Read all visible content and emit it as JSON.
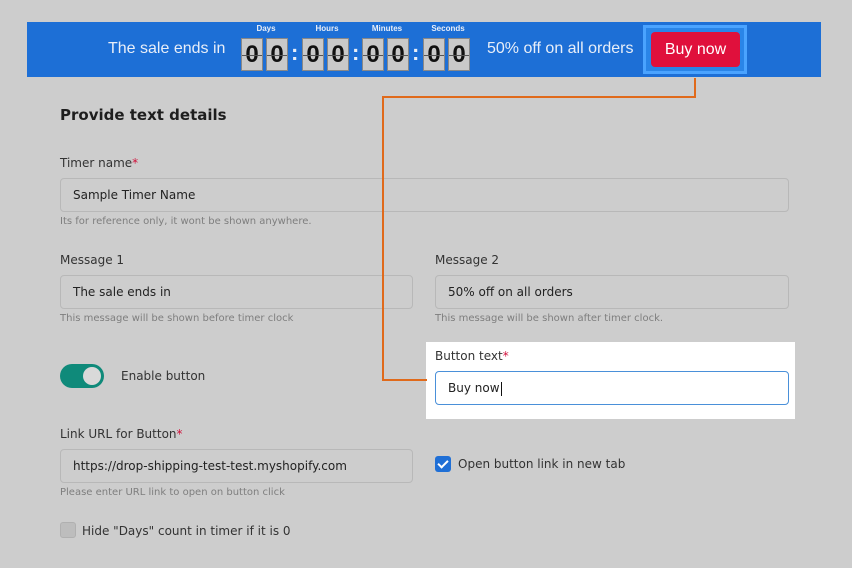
{
  "banner": {
    "message1": "The sale ends in",
    "message2": "50% off on all orders",
    "button_label": "Buy now",
    "timer": {
      "days_label": "Days",
      "hours_label": "Hours",
      "minutes_label": "Minutes",
      "seconds_label": "Seconds",
      "days": [
        "0",
        "0"
      ],
      "hours": [
        "0",
        "0"
      ],
      "minutes": [
        "0",
        "0"
      ],
      "seconds": [
        "0",
        "0"
      ],
      "separator": ":"
    }
  },
  "form": {
    "section_title": "Provide text details",
    "timer_name": {
      "label": "Timer name",
      "required": "*",
      "value": "Sample Timer Name",
      "help": "Its for reference only, it wont be shown anywhere."
    },
    "message1": {
      "label": "Message 1",
      "value": "The sale ends in",
      "help": "This message will be shown before timer clock"
    },
    "message2": {
      "label": "Message 2",
      "value": "50% off on all orders",
      "help": "This message will be shown after timer clock."
    },
    "enable_button": {
      "label": "Enable button",
      "on": true
    },
    "button_text": {
      "label": "Button text",
      "required": "*",
      "value": "Buy now"
    },
    "link_url": {
      "label": "Link URL for Button",
      "required": "*",
      "value": "https://drop-shipping-test-test.myshopify.com",
      "help": "Please enter URL link to open on button click"
    },
    "open_new_tab": {
      "label": "Open button link in new tab",
      "checked": true
    },
    "hide_days": {
      "label": "Hide \"Days\" count in timer if it is 0",
      "checked": false
    }
  },
  "colors": {
    "banner_bg": "#1d6fd6",
    "buy_button": "#e0103c",
    "toggle_on": "#0f8a7a",
    "annotation_line": "#e06a1b"
  }
}
